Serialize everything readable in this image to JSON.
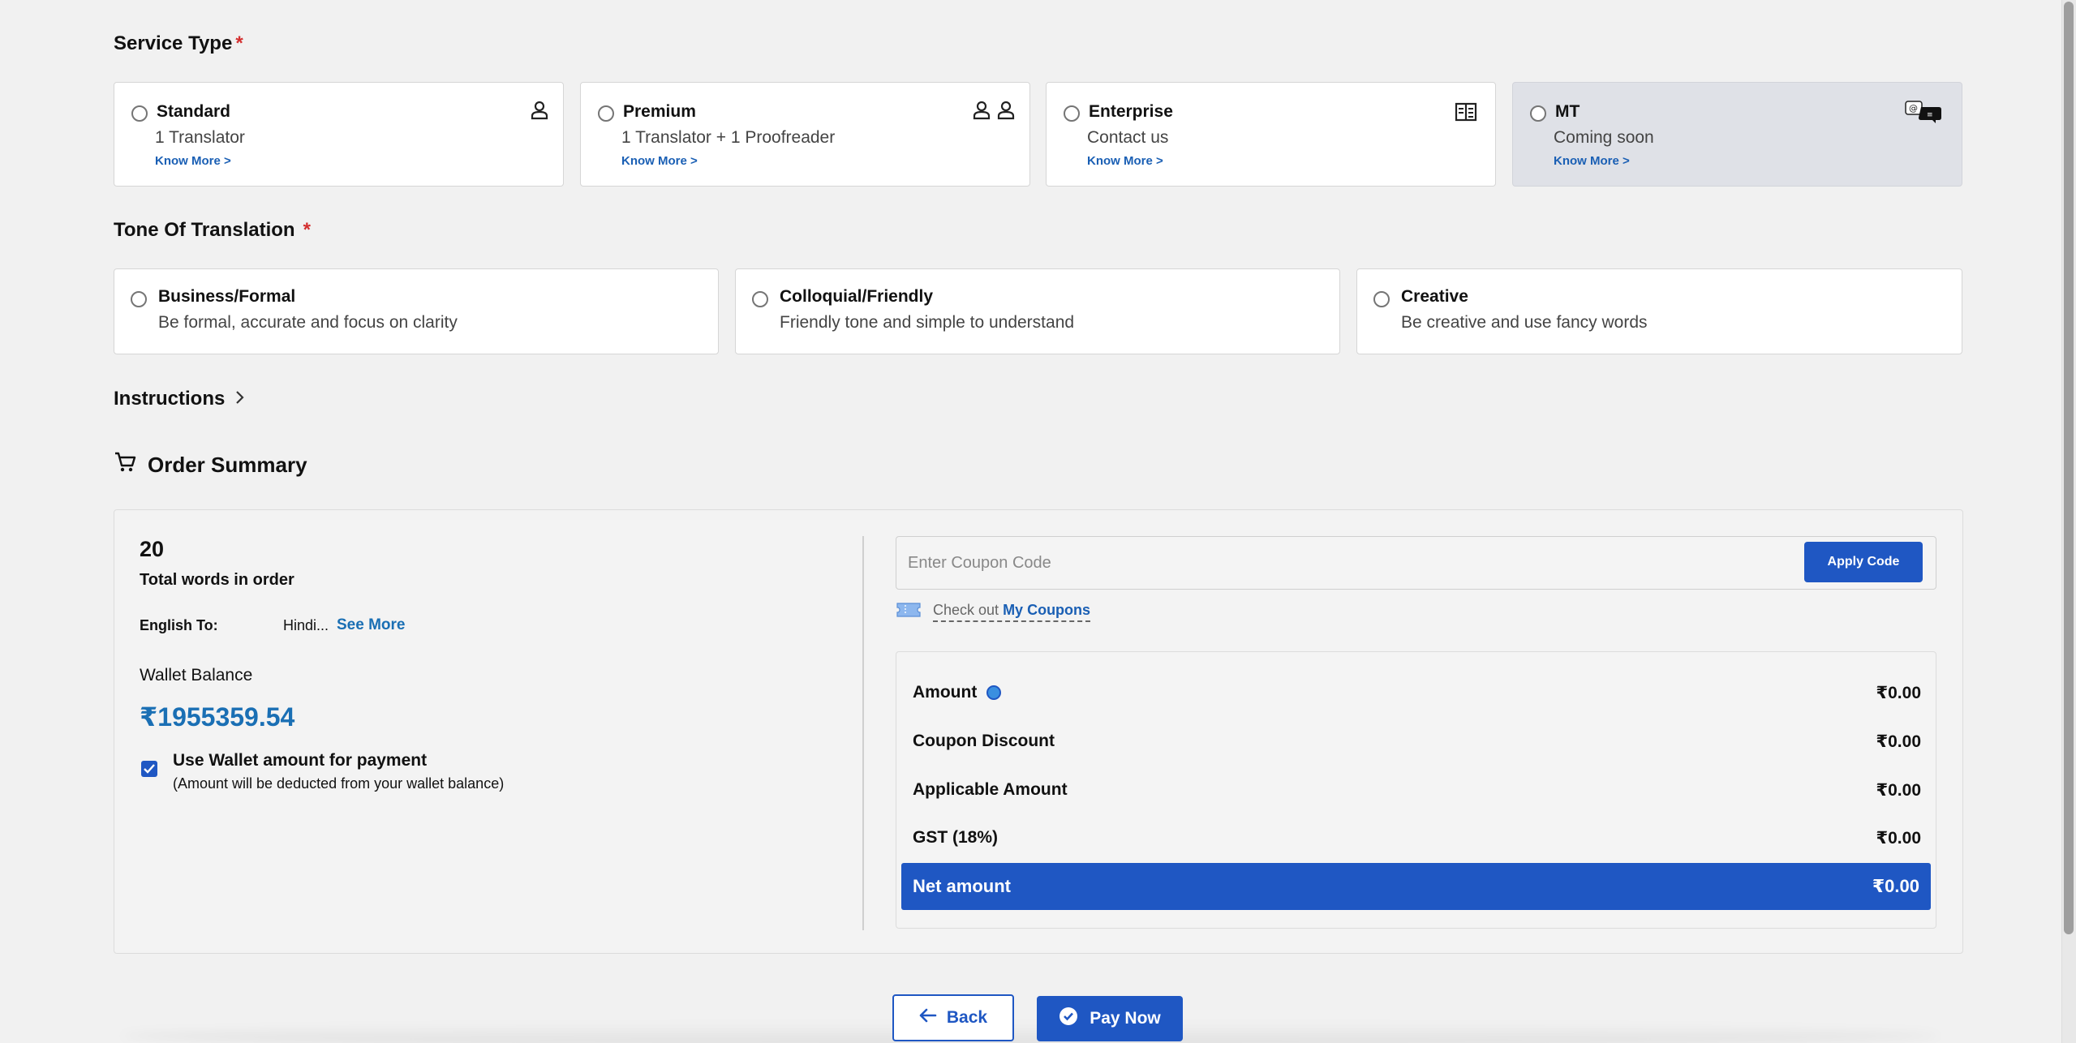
{
  "service_type": {
    "title": "Service Type",
    "required_mark": "*",
    "options": [
      {
        "name": "Standard",
        "subtitle": "1 Translator",
        "link": "Know More >",
        "icon": "person-icon"
      },
      {
        "name": "Premium",
        "subtitle": "1 Translator + 1 Proofreader",
        "link": "Know More >",
        "icon": "two-persons-icon"
      },
      {
        "name": "Enterprise",
        "subtitle": "Contact us",
        "link": "Know More >",
        "icon": "building-icon"
      },
      {
        "name": "MT",
        "subtitle": "Coming soon",
        "link": "Know More >",
        "icon": "machine-translation-icon"
      }
    ]
  },
  "tone": {
    "title": "Tone Of Translation",
    "required_mark": "*",
    "options": [
      {
        "name": "Business/Formal",
        "subtitle": "Be formal, accurate and focus on clarity"
      },
      {
        "name": "Colloquial/Friendly",
        "subtitle": "Friendly tone and simple to understand"
      },
      {
        "name": "Creative",
        "subtitle": "Be creative and use fancy words"
      }
    ]
  },
  "instructions": {
    "label": "Instructions"
  },
  "order_summary": {
    "title": "Order Summary",
    "word_count": "20",
    "word_label": "Total words in order",
    "language_label": "English To:",
    "language_value": "Hindi...",
    "see_more": "See More",
    "wallet_label": "Wallet Balance",
    "wallet_value": "₹1955359.54",
    "use_wallet_label": "Use Wallet amount for payment",
    "use_wallet_note": "(Amount will be deducted from your wallet balance)",
    "use_wallet_checked": true
  },
  "coupon": {
    "placeholder": "Enter Coupon Code",
    "apply_label": "Apply Code",
    "hint_prefix": "Check out",
    "hint_link": "My Coupons"
  },
  "pricing": {
    "rows": [
      {
        "label": "Amount",
        "value": "₹0.00"
      },
      {
        "label": "Coupon Discount",
        "value": "₹0.00"
      },
      {
        "label": "Applicable Amount",
        "value": "₹0.00"
      },
      {
        "label": "GST (18%)",
        "value": "₹0.00"
      }
    ],
    "net_label": "Net amount",
    "net_value": "₹0.00"
  },
  "actions": {
    "back_label": "Back",
    "pay_label": "Pay Now"
  },
  "colors": {
    "primary": "#1f57c3",
    "link": "#1a5fb4",
    "required": "#d32f2f",
    "disabled_card": "#dfe1e7"
  }
}
